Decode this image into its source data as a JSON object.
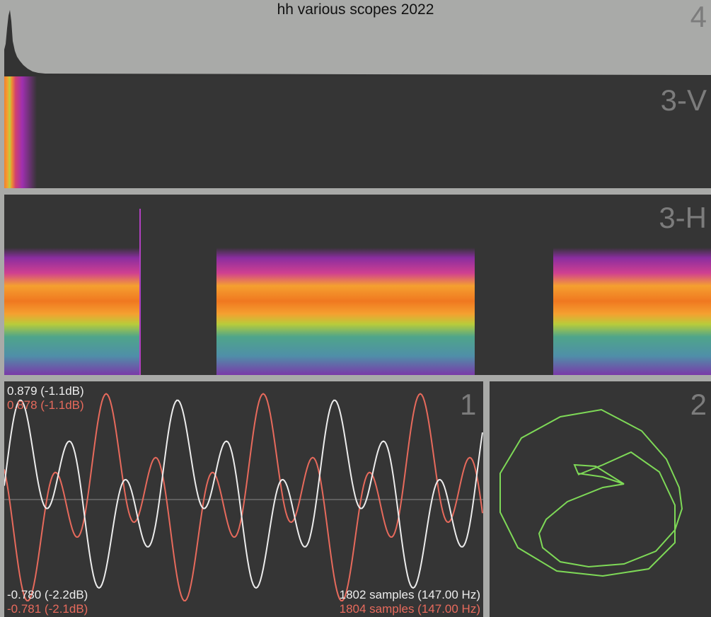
{
  "title": "hh various scopes 2022",
  "panels": {
    "spectrum": {
      "number": "4"
    },
    "spectrogram_v": {
      "number": "3-V"
    },
    "spectrogram_h": {
      "number": "3-H"
    },
    "oscilloscope": {
      "number": "1",
      "max_white": "0.879 (-1.1dB)",
      "max_red": "0.878 (-1.1dB)",
      "min_white": "-0.780 (-2.2dB)",
      "min_red": "-0.781 (-2.1dB)",
      "samples_white": "1802 samples (147.00 Hz)",
      "samples_red": "1804 samples (147.00 Hz)"
    },
    "lissajous": {
      "number": "2"
    }
  },
  "colors": {
    "background": "#a9aaa8",
    "panel": "#353535",
    "white_trace": "#ededed",
    "red_trace": "#e76a5c",
    "lissajous": "#7ed957",
    "number_label": "#7c7c7c"
  }
}
